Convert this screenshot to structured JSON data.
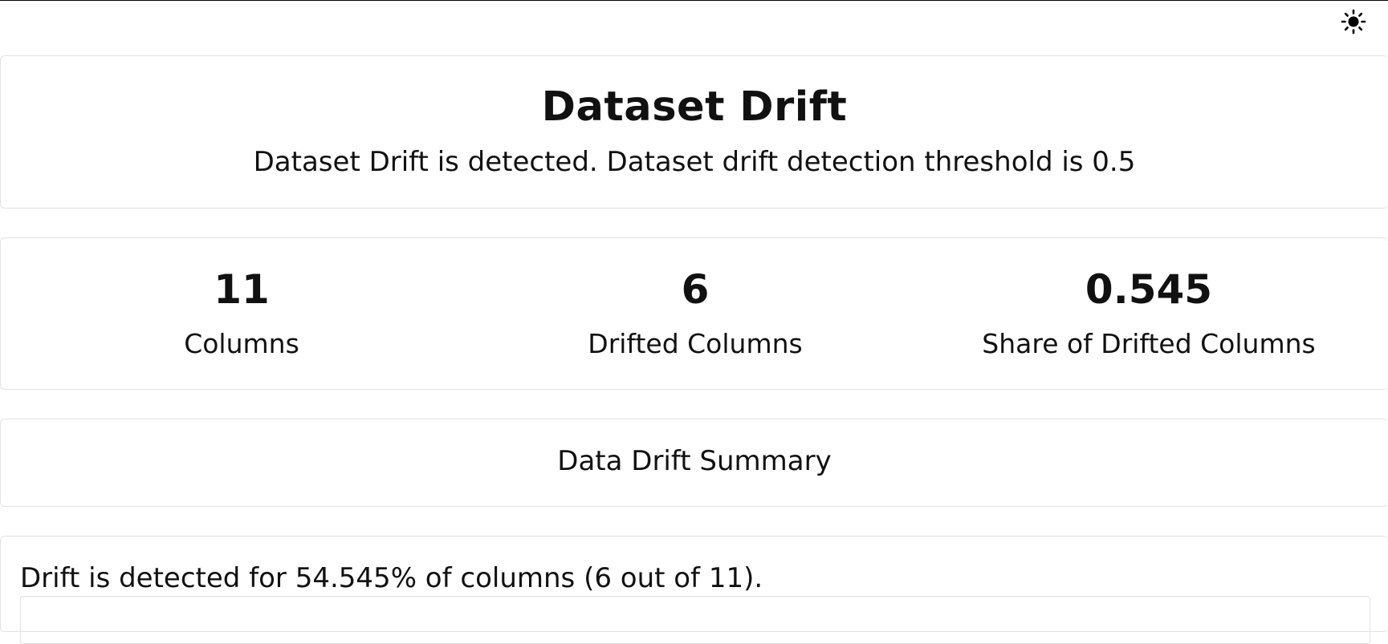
{
  "theme_toggle": {
    "icon": "sun-icon"
  },
  "dataset_drift": {
    "title": "Dataset Drift",
    "subtitle": "Dataset Drift is detected. Dataset drift detection threshold is 0.5"
  },
  "stats": [
    {
      "value": "11",
      "label": "Columns"
    },
    {
      "value": "6",
      "label": "Drifted Columns"
    },
    {
      "value": "0.545",
      "label": "Share of Drifted Columns"
    }
  ],
  "summary": {
    "heading": "Data Drift Summary"
  },
  "detail": {
    "text": "Drift is detected for 54.545% of columns (6 out of 11)."
  }
}
